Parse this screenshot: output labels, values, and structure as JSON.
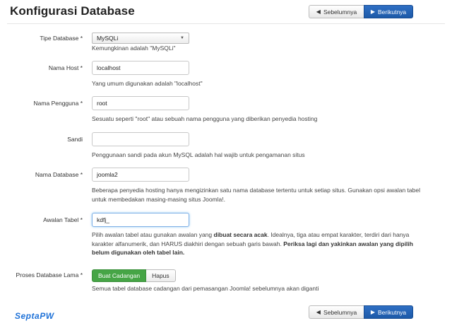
{
  "page": {
    "title": "Konfigurasi Database"
  },
  "nav": {
    "prev_label": "Sebelumnya",
    "next_label": "Berikutnya",
    "prev_icon": "arrow-left-icon",
    "next_icon": "arrow-right-icon"
  },
  "fields": {
    "db_type": {
      "label": "Tipe Database *",
      "value": "MySQLi",
      "help": "Kemungkinan adalah \"MySQLi\""
    },
    "host": {
      "label": "Nama Host *",
      "value": "localhost",
      "help": "Yang umum digunakan adalah \"localhost\""
    },
    "user": {
      "label": "Nama Pengguna *",
      "value": "root",
      "help": "Sesuatu seperti \"root\" atau sebuah nama pengguna yang diberikan penyedia hosting"
    },
    "password": {
      "label": "Sandi",
      "value": "",
      "help": "Penggunaan sandi pada akun MySQL adalah hal wajib untuk pengamanan situs"
    },
    "db_name": {
      "label": "Nama Database *",
      "value": "joomla2",
      "help": "Beberapa penyedia hosting hanya mengizinkan satu nama database tertentu untuk setiap situs. Gunakan opsi awalan tabel untuk membedakan masing-masing situs Joomla!."
    },
    "prefix": {
      "label": "Awalan Tabel *",
      "value": "kdfj_",
      "help_1": "Pilih awalan tabel atau gunakan awalan yang ",
      "help_bold_1": "dibuat secara acak",
      "help_2": ". Idealnya, tiga atau empat karakter, terdiri dari hanya karakter alfanumerik, dan HARUS diakhiri dengan sebuah garis bawah. ",
      "help_bold_2": "Periksa lagi dan yakinkan awalan yang dipilih belum digunakan oleh tabel lain."
    },
    "old_db": {
      "label": "Proses Database Lama *",
      "opt_backup": "Buat Cadangan",
      "opt_remove": "Hapus",
      "help": "Semua tabel database cadangan dari pemasangan Joomla! sebelumnya akan diganti"
    }
  },
  "watermark": {
    "part1": "Septa",
    "part2": "PW"
  },
  "colors": {
    "primary": "#1d5aa8",
    "success": "#46a546",
    "watermark": "#1f72d8"
  }
}
